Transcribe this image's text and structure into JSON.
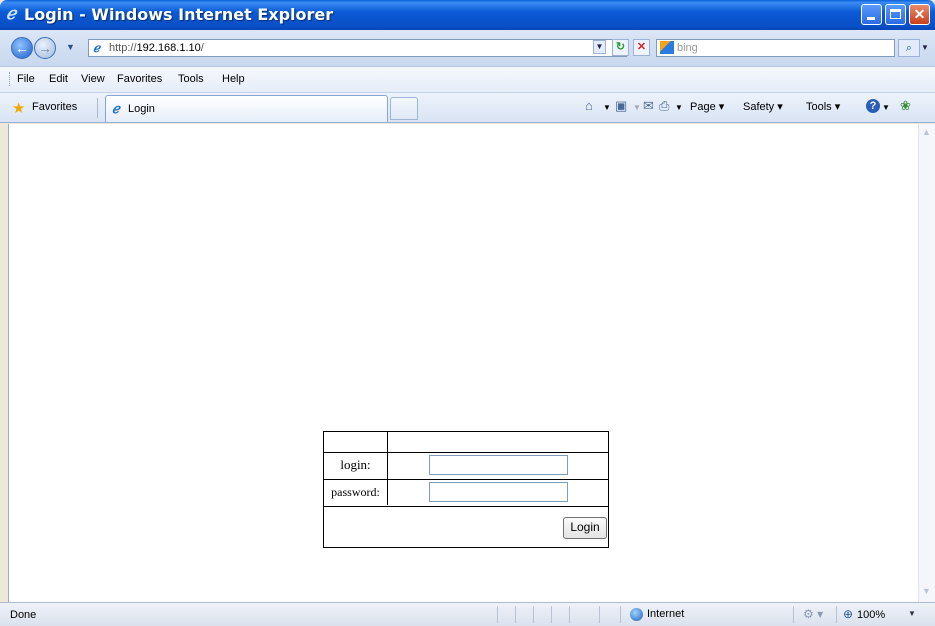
{
  "window": {
    "title": "Login - Windows Internet Explorer"
  },
  "address": {
    "url_prefix": "http://",
    "url_host": "192.168.1.10",
    "url_suffix": "/"
  },
  "search": {
    "placeholder": "bing"
  },
  "menu": [
    "File",
    "Edit",
    "View",
    "Favorites",
    "Tools",
    "Help"
  ],
  "favorites": {
    "label": "Favorites"
  },
  "tab": {
    "label": "Login"
  },
  "command_bar": {
    "page": "Page",
    "safety": "Safety",
    "tools": "Tools"
  },
  "form": {
    "login_label": "login:",
    "password_label": "password:",
    "login_value": "",
    "password_value": "",
    "submit_label": "Login"
  },
  "status": {
    "text": "Done",
    "zone": "Internet",
    "zoom": "100%"
  },
  "icons": {
    "title": "ie-logo-icon",
    "back": "back-arrow-icon",
    "forward": "forward-arrow-icon",
    "page": "ie-page-icon",
    "refresh": "refresh-icon",
    "stop": "stop-icon",
    "search_provider": "bing-logo-icon",
    "search": "magnifier-icon",
    "favorites": "star-icon",
    "home": "home-icon",
    "feeds": "rss-feed-icon",
    "mail": "mail-icon",
    "print": "printer-icon",
    "help": "help-icon",
    "research": "research-icon",
    "internet_zone": "globe-icon",
    "protected_mode": "protected-mode-icon",
    "zoom": "zoom-icon"
  }
}
